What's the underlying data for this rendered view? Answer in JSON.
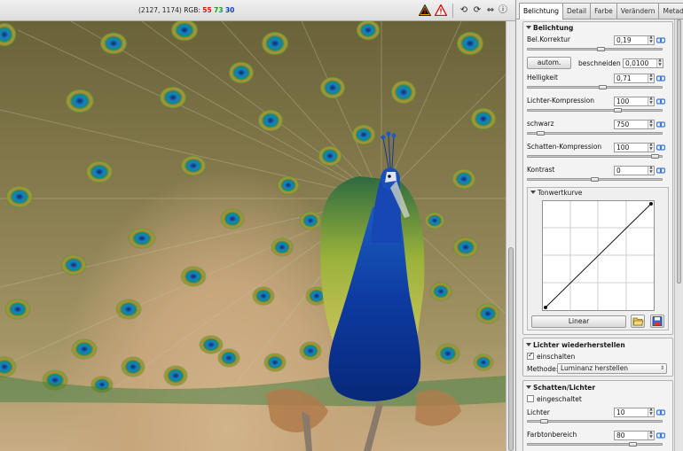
{
  "status": {
    "coords": "(2127, 1174)",
    "rgb_label": "RGB:",
    "r": "55",
    "g": "73",
    "b": "30"
  },
  "tabs": [
    "Belichtung",
    "Detail",
    "Farbe",
    "Verändern",
    "Metadata"
  ],
  "exposure": {
    "title": "Belichtung",
    "rows": [
      {
        "label": "Bel.Korrektur",
        "value": "0,19",
        "level": 0.55
      },
      {
        "label": "Helligkeit",
        "value": "0,71",
        "level": 0.56
      },
      {
        "label": "Lichter-Kompression",
        "value": "100",
        "level": 0.68
      },
      {
        "label": "schwarz",
        "value": "750",
        "level": 0.07
      },
      {
        "label": "Schatten-Kompression",
        "value": "100",
        "level": 0.98
      },
      {
        "label": "Kontrast",
        "value": "0",
        "level": 0.5
      }
    ],
    "auto_button": "autom.",
    "clip_label": "beschneiden",
    "clip_value": "0,0100"
  },
  "tonecurve": {
    "title": "Tonwertkurve",
    "type_button": "Linear"
  },
  "highlight": {
    "title": "Lichter wiederherstellen",
    "enable_label": "einschalten",
    "enabled": true,
    "method_label": "Methode:",
    "method_value": "Luminanz herstellen"
  },
  "shadows": {
    "title": "Schatten/Lichter",
    "enable_label": "eingeschaltet",
    "enabled": false,
    "rows": [
      {
        "label": "Lichter",
        "value": "10",
        "level": 0.1
      },
      {
        "label": "Farbtonbereich",
        "value": "80",
        "level": 0.8
      }
    ]
  },
  "colors": {
    "accent_link": "#3a7bd5",
    "red": "#d11111",
    "green": "#1a9a1a",
    "blue": "#1438c8"
  },
  "icons": [
    "warning-triangle-icon",
    "warning-outline-icon",
    "rotate-left-icon",
    "rotate-right-icon",
    "flip-icon",
    "info-icon",
    "link-icon",
    "folder-open-icon",
    "save-icon"
  ]
}
